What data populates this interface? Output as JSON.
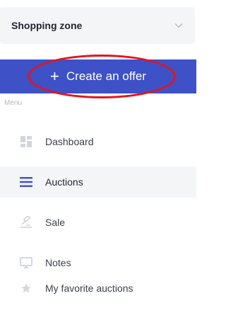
{
  "zone_select": {
    "label": "Shopping zone",
    "icon": "chevron-down-icon"
  },
  "create_button": {
    "label": "Create an offer",
    "icon": "plus-icon",
    "color": "#3f51c6"
  },
  "annotation": {
    "color": "#e0161e"
  },
  "menu": {
    "caption": "Menu",
    "items": [
      {
        "label": "Dashboard",
        "icon": "dashboard-icon",
        "active": false
      },
      {
        "label": "Auctions",
        "icon": "hamburger-list-icon",
        "active": true
      },
      {
        "label": "Sale",
        "icon": "gavel-icon",
        "active": false
      },
      {
        "label": "Notes",
        "icon": "monitor-icon",
        "active": false
      },
      {
        "label": "My favorite auctions",
        "icon": "star-icon",
        "active": false
      }
    ]
  }
}
